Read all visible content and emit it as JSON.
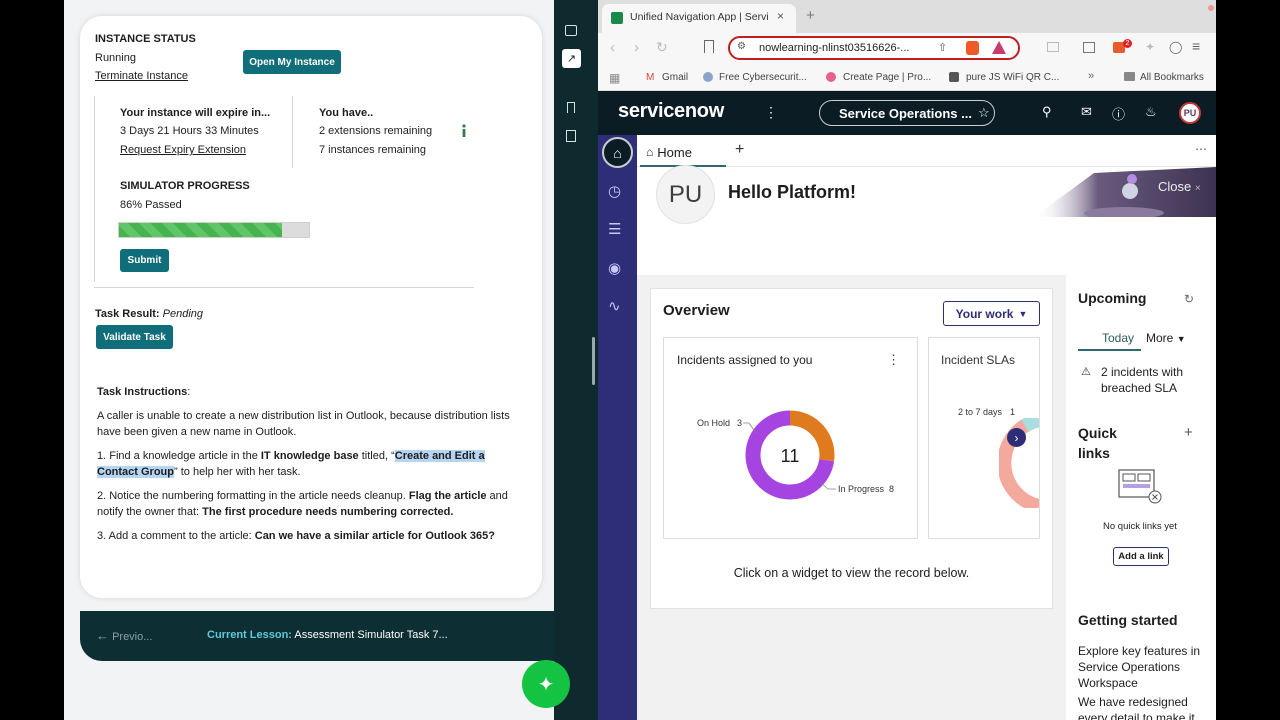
{
  "lesson": {
    "instance_status_heading": "INSTANCE STATUS",
    "instance_state": "Running",
    "terminate_link": "Terminate Instance",
    "open_instance_button": "Open My Instance",
    "expire_heading": "Your instance will expire in...",
    "expire_time": "3 Days 21 Hours 33 Minutes",
    "request_extension_link": "Request Expiry Extension",
    "you_have_heading": "You have..",
    "extensions_remaining": "2 extensions remaining",
    "instances_remaining": "7 instances remaining",
    "progress_heading": "SIMULATOR PROGRESS",
    "progress_text": "86% Passed",
    "progress_percent": 86,
    "submit_button": "Submit",
    "task_result_label": "Task Result:",
    "task_result_value": "Pending",
    "validate_button": "Validate Task",
    "instructions_heading": "Task Instructions",
    "instructions_colon": ":",
    "intro": "A caller is unable to create a new distribution list in Outlook, because distribution lists have been given a new name in Outlook.",
    "step1": {
      "a": "1. Find a knowledge article in the ",
      "b": "IT knowledge base",
      "c": " titled, “",
      "d": "Create and Edit a Contact Group",
      "e": "” to help her with her task."
    },
    "step2": {
      "a": "2. Notice the numbering formatting in the article needs cleanup. ",
      "b": "Flag the article",
      "c": " and notify the owner that: ",
      "d": "The first procedure needs numbering corrected."
    },
    "step3": {
      "a": "3. Add a comment to the article: ",
      "b": "Can we have a similar article for Outlook 365?"
    },
    "prev_button": "Previo...",
    "current_lesson_label": "Current Lesson:",
    "current_lesson_value": "Assessment Simulator Task 7..."
  },
  "browser": {
    "tab_title": "Unified Navigation App | Servi",
    "url": "nowlearning-nlinst03516626-...",
    "extension_badge": "2",
    "bookmarks": [
      "Gmail",
      "Free Cybersecurit...",
      "Create Page | Pro...",
      "pure JS WiFi QR C..."
    ],
    "all_bookmarks": "All Bookmarks"
  },
  "servicenow": {
    "logo": "servicenow",
    "workspace": "Service Operations ...",
    "avatar_initials": "PU",
    "home_tab": "Home",
    "greeting": "Hello Platform!",
    "close_banner": "Close",
    "overview_title": "Overview",
    "your_work_button": "Your work",
    "card1_title": "Incidents assigned to you",
    "donut_total": "11",
    "donut_segments": [
      {
        "label": "On Hold",
        "value": 3,
        "color": "#e07a1f"
      },
      {
        "label": "In Progress",
        "value": 8,
        "color": "#a544e0"
      }
    ],
    "card2_title": "Incident SLAs",
    "card2_label": "2 to 7 days",
    "card2_value": "1",
    "overview_footer": "Click on a widget to view the record below.",
    "upcoming_title": "Upcoming",
    "today_tab": "Today",
    "more_tab": "More",
    "sla_alert": "2 incidents with breached SLA",
    "quick_links_title": "Quick links",
    "no_quick_links": "No quick links yet",
    "add_link_button": "Add a link",
    "getting_started_title": "Getting started",
    "getting_started_text1": "Explore key features in Service Operations Workspace",
    "getting_started_text2": "We have redesigned every detail to make it"
  }
}
